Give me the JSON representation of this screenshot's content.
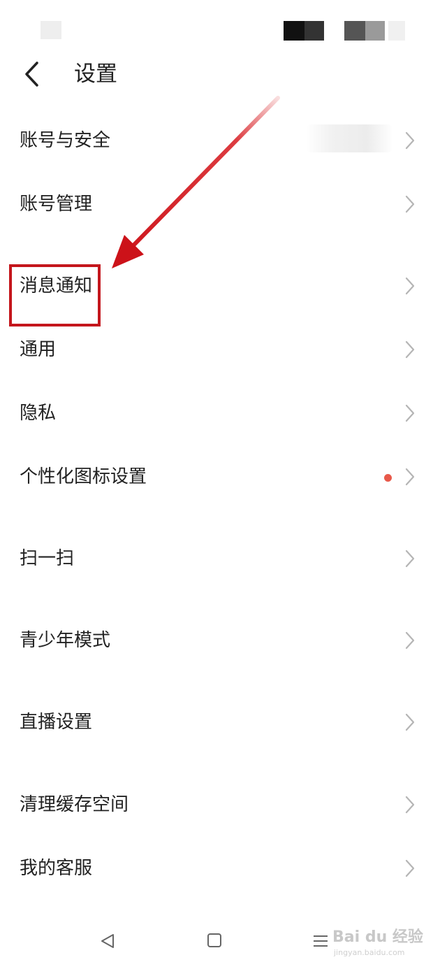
{
  "header": {
    "title": "设置",
    "back_icon": "chevron-left-icon"
  },
  "settings": {
    "items": [
      {
        "label": "账号与安全"
      },
      {
        "label": "账号管理"
      },
      {
        "label": "消息通知"
      },
      {
        "label": "通用"
      },
      {
        "label": "隐私"
      },
      {
        "label": "个性化图标设置",
        "badge": "red-dot"
      },
      {
        "label": "扫一扫"
      },
      {
        "label": "青少年模式"
      },
      {
        "label": "直播设置"
      },
      {
        "label": "清理缓存空间"
      },
      {
        "label": "我的客服"
      }
    ],
    "chevron_icon": "chevron-right-icon"
  },
  "annotation": {
    "highlighted_item": "消息通知",
    "color": "#c4161c"
  },
  "navbar": {
    "icons": [
      "back-triangle-icon",
      "home-square-icon",
      "menu-lines-icon"
    ]
  },
  "watermark": {
    "text": "Bai du 经验",
    "sub": "jingyan.baidu.com"
  },
  "colors": {
    "text": "#222222",
    "chevron": "#b5b5b5",
    "badge": "#e8594a"
  }
}
